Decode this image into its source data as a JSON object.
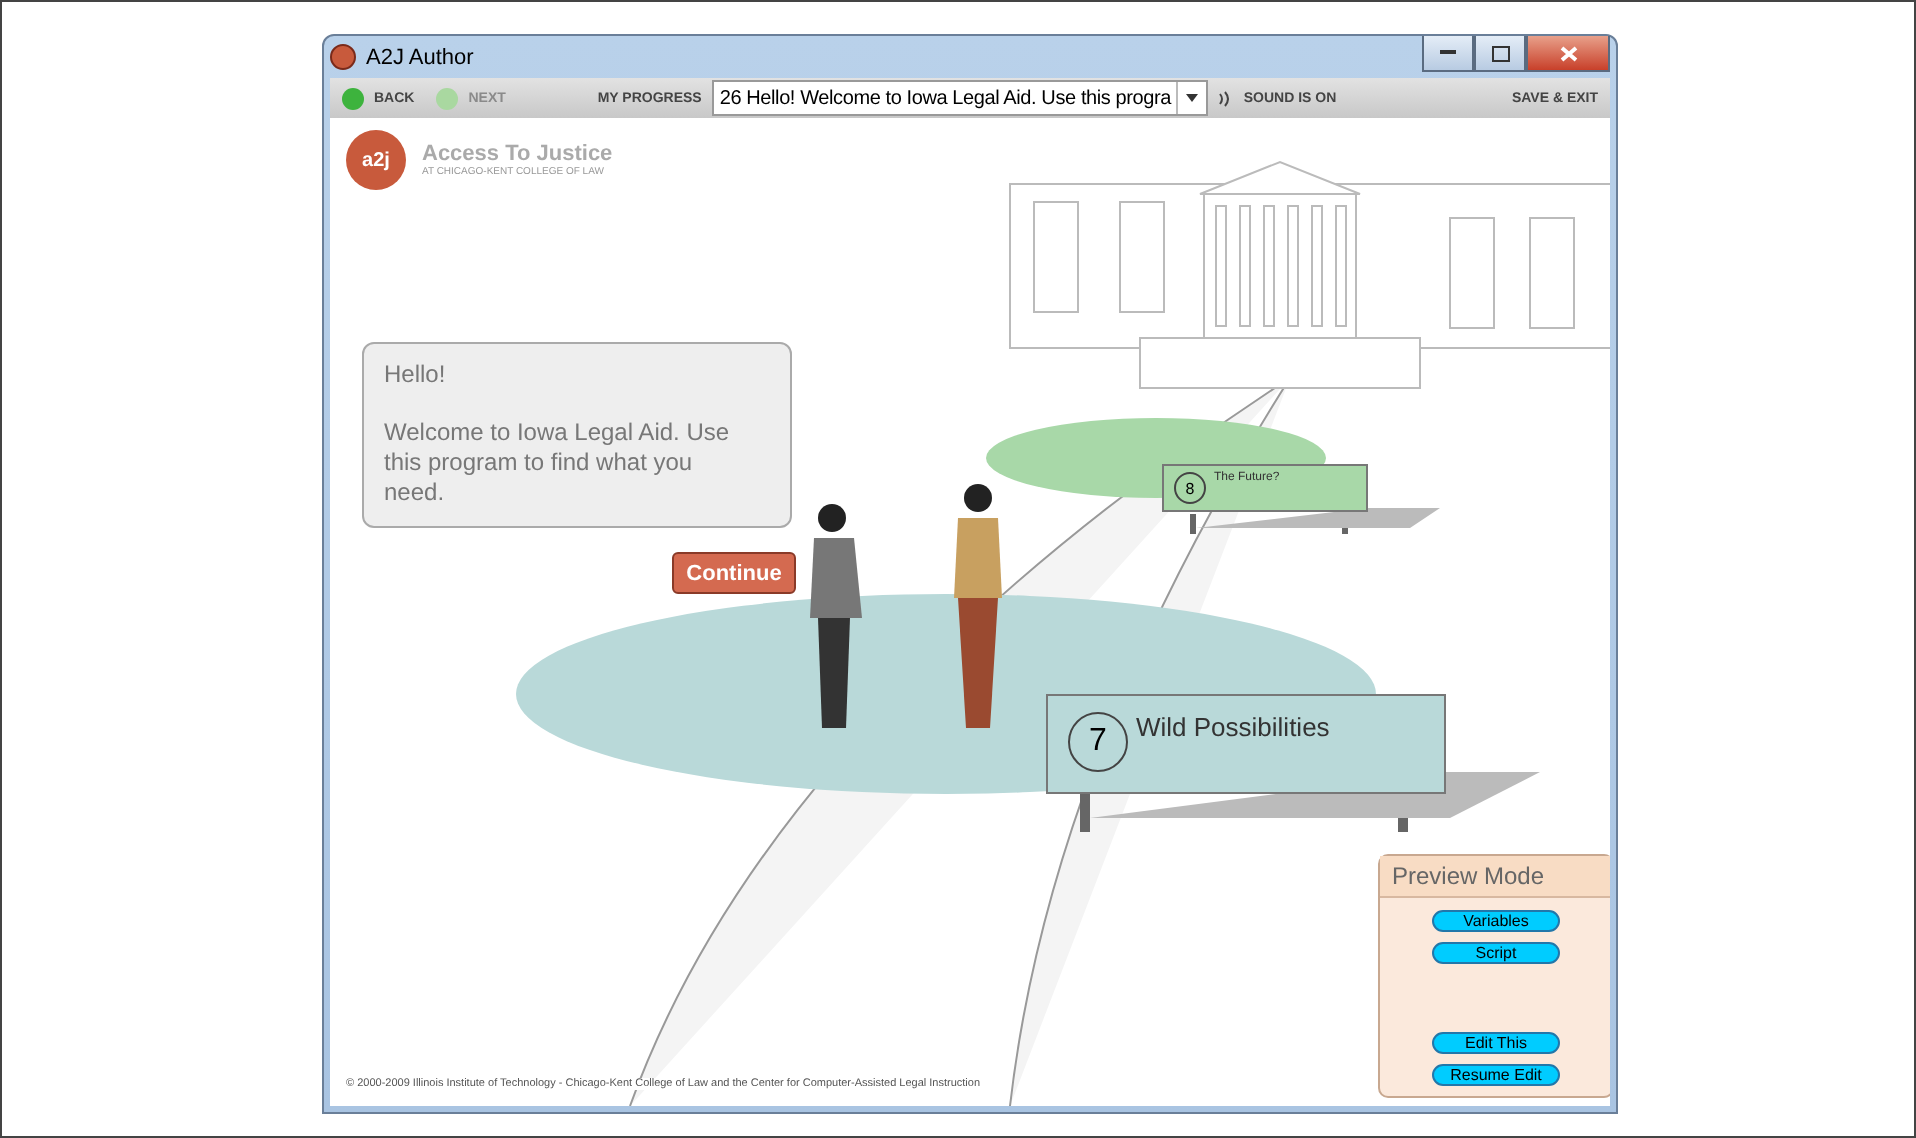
{
  "window": {
    "title": "A2J Author"
  },
  "toolbar": {
    "back": {
      "label": "BACK",
      "disabled": false
    },
    "next": {
      "label": "NEXT",
      "disabled": true
    },
    "progress_label": "MY PROGRESS",
    "progress_value": "26 Hello! Welcome to Iowa Legal Aid. Use this progra",
    "sound": "SOUND IS ON",
    "save_exit": "SAVE & EXIT"
  },
  "logo": {
    "mark": "a2j",
    "title": "Access To Justice",
    "subtitle": "AT CHICAGO-KENT COLLEGE OF LAW"
  },
  "bubble": {
    "greeting": "Hello!",
    "message": "Welcome to Iowa Legal Aid. Use this program to find what you need."
  },
  "continue_button": "Continue",
  "signs": [
    {
      "number": "8",
      "label": "The Future?",
      "kind": "small",
      "color": "#a8d8a8"
    },
    {
      "number": "7",
      "label": "Wild Possibilities",
      "kind": "large",
      "color": "#b9d9d9"
    }
  ],
  "preview": {
    "title": "Preview Mode",
    "buttons": [
      "Variables",
      "Script"
    ],
    "bottom_buttons": [
      "Edit This",
      "Resume Edit"
    ]
  },
  "footer": "© 2000-2009 Illinois Institute of Technology - Chicago-Kent College of Law and the Center for Computer-Assisted Legal Instruction"
}
